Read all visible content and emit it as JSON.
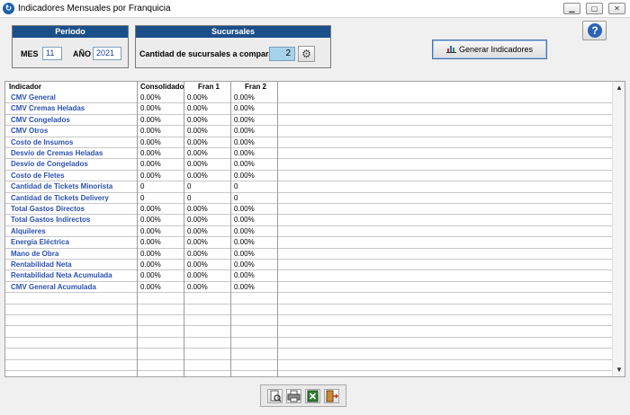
{
  "window": {
    "title": "Indicadores Mensuales por Franquicia"
  },
  "periodo": {
    "header": "Periodo",
    "mes_label": "MES",
    "mes_value": "11",
    "anio_label": "AÑO",
    "anio_value": "2021"
  },
  "sucursales": {
    "header": "Sucursales",
    "label": "Cantidad de sucursales a comparar",
    "value": "2"
  },
  "generate_button": "Generar Indicadores",
  "help_label": "?",
  "table": {
    "columns": [
      "Indicador",
      "Consolidado",
      "Fran 1",
      "Fran 2"
    ],
    "rows": [
      [
        "CMV General",
        "0.00%",
        "0.00%",
        "0.00%"
      ],
      [
        "CMV Cremas Heladas",
        "0.00%",
        "0.00%",
        "0.00%"
      ],
      [
        "CMV Congelados",
        "0.00%",
        "0.00%",
        "0.00%"
      ],
      [
        "CMV Otros",
        "0.00%",
        "0.00%",
        "0.00%"
      ],
      [
        "Costo de Insumos",
        "0.00%",
        "0.00%",
        "0.00%"
      ],
      [
        "Desvío de Cremas Heladas",
        "0.00%",
        "0.00%",
        "0.00%"
      ],
      [
        "Desvío de Congelados",
        "0.00%",
        "0.00%",
        "0.00%"
      ],
      [
        "Costo de Fletes",
        "0.00%",
        "0.00%",
        "0.00%"
      ],
      [
        "Cantidad de Tickets Minorista",
        "0",
        "0",
        "0"
      ],
      [
        "Cantidad de Tickets Delivery",
        "0",
        "0",
        "0"
      ],
      [
        "Total Gastos Directos",
        "0.00%",
        "0.00%",
        "0.00%"
      ],
      [
        "Total Gastos Indirectos",
        "0.00%",
        "0.00%",
        "0.00%"
      ],
      [
        "Alquileres",
        "0.00%",
        "0.00%",
        "0.00%"
      ],
      [
        "Energía Eléctrica",
        "0.00%",
        "0.00%",
        "0.00%"
      ],
      [
        "Mano de Obra",
        "0.00%",
        "0.00%",
        "0.00%"
      ],
      [
        "Rentabilidad Neta",
        "0.00%",
        "0.00%",
        "0.00%"
      ],
      [
        "Rentabilidad Neta Acumulada",
        "0.00%",
        "0.00%",
        "0.00%"
      ],
      [
        "CMV General Acumulada",
        "0.00%",
        "0.00%",
        "0.00%"
      ]
    ],
    "empty_rows": 8
  },
  "toolbar": {
    "icons": [
      "preview-icon",
      "print-icon",
      "excel-icon",
      "exit-icon"
    ]
  },
  "colors": {
    "group_header": "#1b4f8a",
    "indicator_text": "#2b50b0",
    "count_field": "#a7d3ea"
  }
}
